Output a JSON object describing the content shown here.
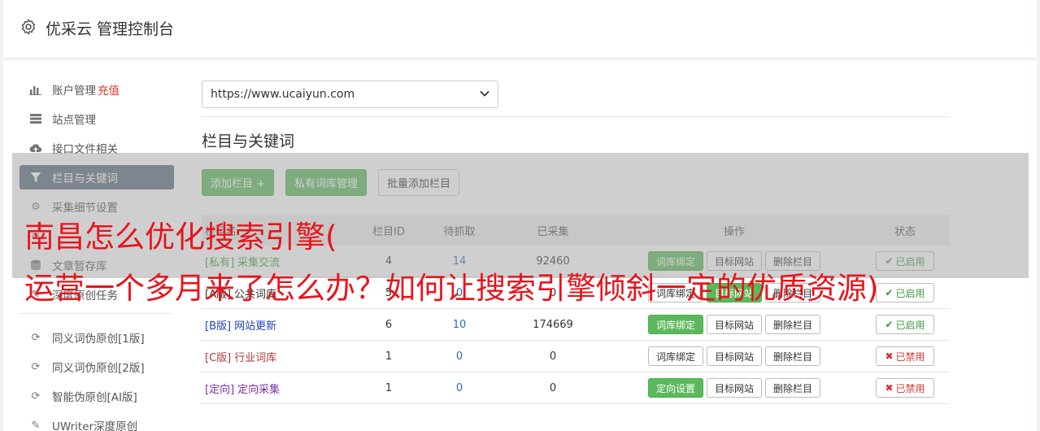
{
  "header": {
    "title": "优采云 管理控制台",
    "icon": "gear-icon"
  },
  "sidebar": {
    "items": [
      {
        "label": "账户管理",
        "badge": "充值",
        "icon": "bar-chart-icon"
      },
      {
        "label": "站点管理",
        "icon": "server-icon"
      },
      {
        "label": "接口文件相关",
        "icon": "cloud-upload-icon"
      },
      {
        "label": "栏目与关键词",
        "icon": "filter-icon"
      },
      {
        "label": "采集细节设置",
        "icon": "cogs-icon"
      },
      {
        "label": "",
        "icon": "list-icon"
      },
      {
        "label": "文章暂存库",
        "icon": "database-icon"
      },
      {
        "label": "深度原创任务",
        "icon": "edit-icon"
      }
    ],
    "items2": [
      {
        "label": "同义词伪原创[1版]",
        "icon": "refresh-icon"
      },
      {
        "label": "同义词伪原创[2版]",
        "icon": "refresh-icon"
      },
      {
        "label": "智能伪原创[AI版]",
        "icon": "refresh-icon"
      },
      {
        "label": "UWriter深度原创",
        "icon": "edit-icon"
      }
    ],
    "active_color": "#5b6b7c"
  },
  "main": {
    "site_select": {
      "value": "https://www.ucaiyun.com"
    },
    "section_title": "栏目与关键词",
    "buttons": {
      "add": "添加栏目 +",
      "private_lib": "私有词库管理",
      "batch_add": "批量添加栏目"
    },
    "table": {
      "headers": {
        "name": "栏目名",
        "id": "栏目ID",
        "pending": "待抓取",
        "done": "已采集",
        "ops": "操作",
        "status": "状态"
      },
      "rows": [
        {
          "tag": "[私有]",
          "name": "采集交流",
          "id": "4",
          "pending": "14",
          "done": "92460",
          "op1": "词库绑定",
          "op1_green": true,
          "op2": "目标网站",
          "op2_green": false,
          "op3": "删除栏目",
          "status": "已启用",
          "enabled": true,
          "color": "#3c9a3c"
        },
        {
          "tag": "[A版]",
          "name": "公共词库",
          "id": "5",
          "pending": "0",
          "done": "0",
          "op1": "词库绑定",
          "op1_green": false,
          "op2": "目标网站",
          "op2_green": true,
          "op3": "删除栏目",
          "status": "已启用",
          "enabled": true,
          "color": "#333333"
        },
        {
          "tag": "[B版]",
          "name": "网站更新",
          "id": "6",
          "pending": "10",
          "done": "174669",
          "op1": "词库绑定",
          "op1_green": true,
          "op2": "目标网站",
          "op2_green": false,
          "op3": "删除栏目",
          "status": "已启用",
          "enabled": true,
          "color": "#1f3fbf"
        },
        {
          "tag": "[C版]",
          "name": "行业词库",
          "id": "1",
          "pending": "0",
          "done": "0",
          "op1": "词库绑定",
          "op1_green": false,
          "op2": "目标网站",
          "op2_green": false,
          "op3": "删除栏目",
          "status": "已禁用",
          "enabled": false,
          "color": "#b03a3a"
        },
        {
          "tag": "[定向]",
          "name": "定向采集",
          "id": "1",
          "pending": "0",
          "done": "0",
          "op1": "定向设置",
          "op1_green": true,
          "op2": "目标网站",
          "op2_green": false,
          "op3": "删除栏目",
          "status": "已禁用",
          "enabled": false,
          "color": "#7b2fa8"
        }
      ]
    }
  },
  "overlay": {
    "line1": "南昌怎么优化搜索引擎(",
    "line2": "运营一个多月来了怎么办？如何让搜索引擎倾斜一定的优质资源)",
    "color": "#e8141c"
  }
}
